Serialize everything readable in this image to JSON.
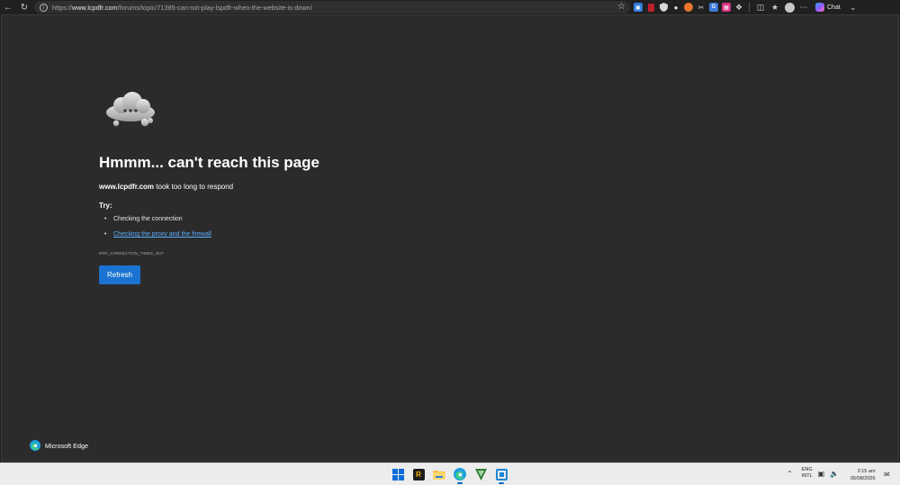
{
  "browser": {
    "url_prefix": "https://",
    "url_host": "www.lcpdfr.com",
    "url_path": "/forums/topic/71385-can-not-play-lspdfr-when-the-website-is-down/",
    "chat_label": "Chat"
  },
  "error_page": {
    "title": "Hmmm... can't reach this page",
    "host": "www.lcpdfr.com",
    "subtitle_suffix": " took too long to respond",
    "try_label": "Try:",
    "tips": [
      {
        "text": "Checking the connection"
      },
      {
        "text": "Checking the proxy and the firewall"
      }
    ],
    "error_code": "ERR_CONNECTION_TIMED_OUT",
    "refresh_label": "Refresh",
    "brand": "Microsoft Edge"
  },
  "taskbar": {
    "lang_line1": "ENG",
    "lang_line2": "INTL",
    "time": "3:15 am",
    "date": "05/08/2026"
  },
  "colors": {
    "accent": "#1a73d0",
    "link": "#5aaeff",
    "page_bg": "#2b2b2b"
  },
  "icons": [
    "back-arrow-icon",
    "reload-icon",
    "site-info-icon",
    "favorite-star-icon",
    "settings-icon",
    "avatar",
    "more-icon",
    "copilot-icon",
    "windows-start-icon",
    "edge-icon",
    "file-explorer-icon"
  ]
}
